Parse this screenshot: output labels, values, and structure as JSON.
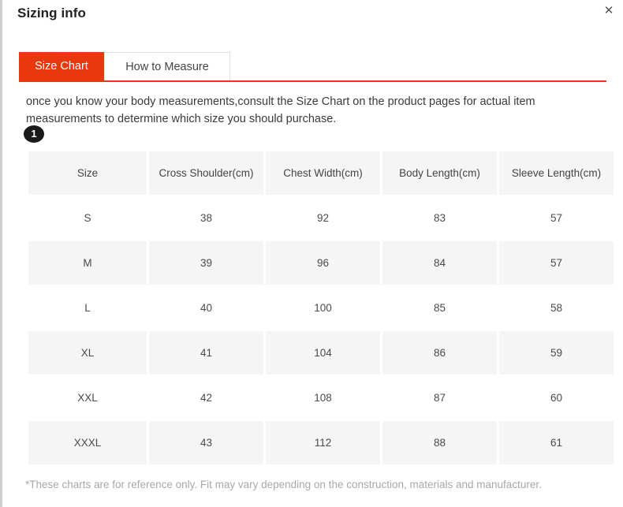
{
  "modal": {
    "title": "Sizing info",
    "close_icon": "close-icon",
    "close_glyph": "✕"
  },
  "tabs": [
    {
      "label": "Size Chart",
      "active": true
    },
    {
      "label": "How to Measure",
      "active": false
    }
  ],
  "description": {
    "text": "once you know your body measurements,consult the Size Chart on the product pages for actual item measurements to determine which size you should purchase.",
    "badge": "1"
  },
  "chart_data": {
    "type": "table",
    "title": "Size Chart",
    "columns": [
      "Size",
      "Cross Shoulder(cm)",
      "Chest Width(cm)",
      "Body Length(cm)",
      "Sleeve Length(cm)"
    ],
    "rows": [
      [
        "S",
        "38",
        "92",
        "83",
        "57"
      ],
      [
        "M",
        "39",
        "96",
        "84",
        "57"
      ],
      [
        "L",
        "40",
        "100",
        "85",
        "58"
      ],
      [
        "XL",
        "41",
        "104",
        "86",
        "59"
      ],
      [
        "XXL",
        "42",
        "108",
        "87",
        "60"
      ],
      [
        "XXXL",
        "43",
        "112",
        "88",
        "61"
      ]
    ]
  },
  "footer": {
    "note": "*These charts are for reference only. Fit may vary depending on the construction, materials and manufacturer."
  },
  "colors": {
    "accent": "#e8380d",
    "header_cell_bg": "#f5f5f5",
    "text": "#4a4a4a",
    "muted": "#a8a8a8",
    "badge_bg": "#1a1a1a"
  }
}
